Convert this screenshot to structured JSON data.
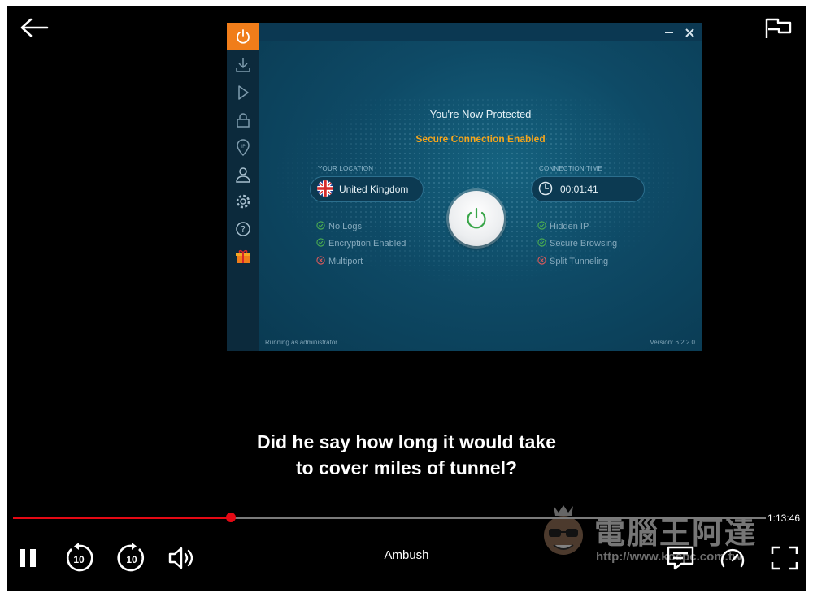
{
  "player": {
    "subtitle_line1": "Did he say how long it would take",
    "subtitle_line2": "to cover miles of tunnel?",
    "title": "Ambush",
    "time_remaining": "1:13:46",
    "progress_fraction": 0.289,
    "icons": [
      "back-arrow-icon",
      "report-flag-icon",
      "pause-icon",
      "rewind-10-icon",
      "forward-10-icon",
      "volume-icon",
      "subtitles-icon",
      "playback-speed-icon",
      "fullscreen-icon"
    ],
    "accent_color": "#e50914"
  },
  "vpn_app": {
    "status_title": "You're Now Protected",
    "status_subtitle": "Secure Connection Enabled",
    "location_label": "YOUR LOCATION",
    "location_value": "United Kingdom",
    "time_label": "CONNECTION TIME",
    "time_value": "00:01:41",
    "features_left": [
      {
        "label": "No Logs",
        "status": "enabled"
      },
      {
        "label": "Encryption Enabled",
        "status": "enabled"
      },
      {
        "label": "Multiport",
        "status": "disabled"
      }
    ],
    "features_right": [
      {
        "label": "Hidden IP",
        "status": "enabled"
      },
      {
        "label": "Secure Browsing",
        "status": "enabled"
      },
      {
        "label": "Split Tunneling",
        "status": "disabled"
      }
    ],
    "footer_left": "Running as administrator",
    "footer_right": "Version: 6.2.2.0",
    "sidebar_icons": [
      "power-icon",
      "download-icon",
      "play-icon",
      "lock-icon",
      "ip-icon",
      "account-icon",
      "settings-icon",
      "help-icon",
      "gift-icon"
    ],
    "colors": {
      "sidebar_active": "#f07d1a",
      "secure_text": "#f4a51c",
      "ok_green": "#4caf50",
      "disabled_red": "#e05a5a"
    }
  },
  "watermark": {
    "text": "電腦王阿達",
    "url": "http://www.kocpc.com.tw"
  }
}
